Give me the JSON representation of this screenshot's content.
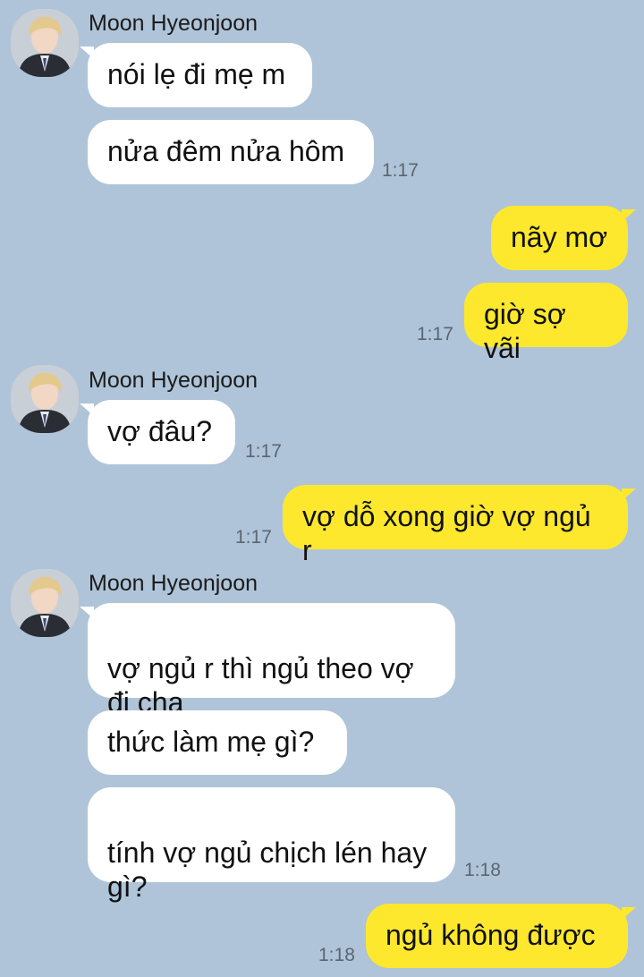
{
  "colors": {
    "background": "#afc4d8",
    "incoming_bubble": "#ffffff",
    "outgoing_bubble": "#fde82e",
    "timestamp": "#5b6672"
  },
  "groups": [
    {
      "sender": "Moon Hyeonjoon",
      "avatar_icon": "profile-photo-icon"
    },
    {
      "sender": "Moon Hyeonjoon",
      "avatar_icon": "profile-photo-icon"
    },
    {
      "sender": "Moon Hyeonjoon",
      "avatar_icon": "profile-photo-icon"
    }
  ],
  "messages": [
    {
      "direction": "in",
      "text": "nói lẹ đi mẹ m",
      "time": ""
    },
    {
      "direction": "in",
      "text": "nửa đêm nửa hôm",
      "time": "1:17"
    },
    {
      "direction": "out",
      "text": "nãy mơ",
      "time": ""
    },
    {
      "direction": "out",
      "text": "giờ sợ vãi",
      "time": "1:17"
    },
    {
      "direction": "in",
      "text": "vợ đâu?",
      "time": "1:17"
    },
    {
      "direction": "out",
      "text": "vợ dỗ xong giờ vợ ngủ r",
      "time": "1:17"
    },
    {
      "direction": "in",
      "text": "vợ ngủ r thì ngủ theo vợ\nđi cha",
      "time": ""
    },
    {
      "direction": "in",
      "text": "thức làm mẹ gì?",
      "time": ""
    },
    {
      "direction": "in",
      "text": "tính vợ ngủ chịch lén hay\ngì?",
      "time": "1:18"
    },
    {
      "direction": "out",
      "text": "ngủ không được",
      "time": "1:18"
    }
  ]
}
